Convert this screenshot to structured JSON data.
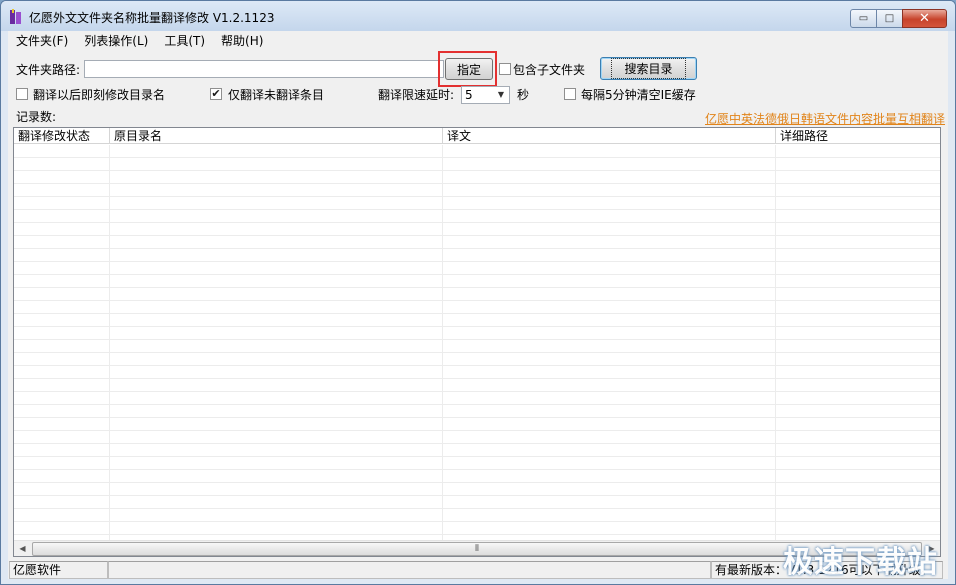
{
  "window": {
    "title": "亿愿外文文件夹名称批量翻译修改 V1.2.1123",
    "minimize_glyph": "▭",
    "maximize_glyph": "□",
    "close_glyph": "✕"
  },
  "menu": {
    "items": [
      "文件夹(F)",
      "列表操作(L)",
      "工具(T)",
      "帮助(H)"
    ]
  },
  "form": {
    "folder_path_label": "文件夹路径:",
    "folder_path_value": "",
    "specify_button": "指定",
    "include_subfolders_label": "包含子文件夹",
    "include_subfolders_checked": false,
    "search_button": "搜索目录",
    "modify_after_translate_label": "翻译以后即刻修改目录名",
    "modify_after_translate_checked": false,
    "only_untranslated_label": "仅翻译未翻译条目",
    "only_untranslated_checked": true,
    "delay_label": "翻译限速延时:",
    "delay_value": "5",
    "delay_unit": "秒",
    "clear_ie_cache_label": "每隔5分钟清空IE缓存",
    "clear_ie_cache_checked": false,
    "record_count_label": "记录数:",
    "promo_link": "亿愿中英法德俄日韩语文件内容批量互相翻译"
  },
  "list": {
    "columns": [
      "翻译修改状态",
      "原目录名",
      "译文",
      "详细路径"
    ],
    "rows": [],
    "scroll_thumb_glyph": "⦀"
  },
  "status": {
    "left": "亿愿软件",
    "right": "有最新版本：V1.3.1216可以下载升级。"
  },
  "watermark": "极速下载站",
  "colors": {
    "link": "#e1841a",
    "highlight_box": "#e33030",
    "close_button": "#c7432b"
  }
}
